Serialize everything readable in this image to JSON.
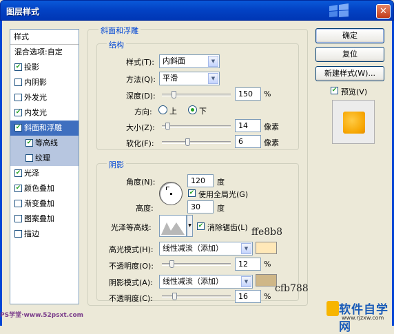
{
  "window": {
    "title": "图层样式"
  },
  "styles_panel": {
    "header": "样式",
    "blend_options": "混合选项:自定",
    "items": [
      {
        "label": "投影",
        "checked": true
      },
      {
        "label": "内阴影",
        "checked": false
      },
      {
        "label": "外发光",
        "checked": false
      },
      {
        "label": "内发光",
        "checked": true
      },
      {
        "label": "斜面和浮雕",
        "checked": true,
        "selected": true
      },
      {
        "label": "等高线",
        "checked": true,
        "sub": true
      },
      {
        "label": "纹理",
        "checked": false,
        "sub": true
      },
      {
        "label": "光泽",
        "checked": true
      },
      {
        "label": "颜色叠加",
        "checked": true
      },
      {
        "label": "渐变叠加",
        "checked": false
      },
      {
        "label": "图案叠加",
        "checked": false
      },
      {
        "label": "描边",
        "checked": false
      }
    ]
  },
  "bevel": {
    "section_title": "斜面和浮雕",
    "structure_title": "结构",
    "style_label": "样式(T):",
    "style_value": "内斜面",
    "technique_label": "方法(Q):",
    "technique_value": "平滑",
    "depth_label": "深度(D):",
    "depth_value": "150",
    "depth_unit": "%",
    "depth_fraction": 0.15,
    "direction_label": "方向:",
    "direction_up": "上",
    "direction_down": "下",
    "direction_selected": "下",
    "size_label": "大小(Z):",
    "size_value": "14",
    "size_unit": "像素",
    "size_fraction": 0.05,
    "soften_label": "软化(F):",
    "soften_value": "6",
    "soften_unit": "像素",
    "soften_fraction": 0.37
  },
  "shading": {
    "title": "阴影",
    "angle_label": "角度(N):",
    "angle_value": "120",
    "angle_unit": "度",
    "global_light_label": "使用全局光(G)",
    "global_light_checked": true,
    "altitude_label": "高度:",
    "altitude_value": "30",
    "altitude_unit": "度",
    "gloss_contour_label": "光泽等高线:",
    "anti_alias_label": "消除锯齿(L)",
    "anti_alias_checked": true,
    "highlight_mode_label": "高光模式(H):",
    "highlight_mode_value": "线性减淡（添加）",
    "highlight_color": "#ffe8b8",
    "highlight_color_annotation": "ffe8b8",
    "highlight_opacity_label": "不透明度(O):",
    "highlight_opacity_value": "12",
    "highlight_opacity_unit": "%",
    "highlight_opacity_fraction": 0.12,
    "shadow_mode_label": "阴影模式(A):",
    "shadow_mode_value": "线性减淡（添加）",
    "shadow_color": "#cfb788",
    "shadow_color_annotation": "cfb788",
    "shadow_opacity_label": "不透明度(C):",
    "shadow_opacity_value": "16",
    "shadow_opacity_unit": "%",
    "shadow_opacity_fraction": 0.16
  },
  "buttons": {
    "ok": "确定",
    "reset": "复位",
    "new_style": "新建样式(W)...",
    "preview_label": "预览(V)",
    "preview_checked": true
  },
  "watermarks": {
    "left": "PS学堂·www.52psxt.com",
    "right_big": "软件自学网",
    "right_small": "www.rjzxw.com"
  }
}
